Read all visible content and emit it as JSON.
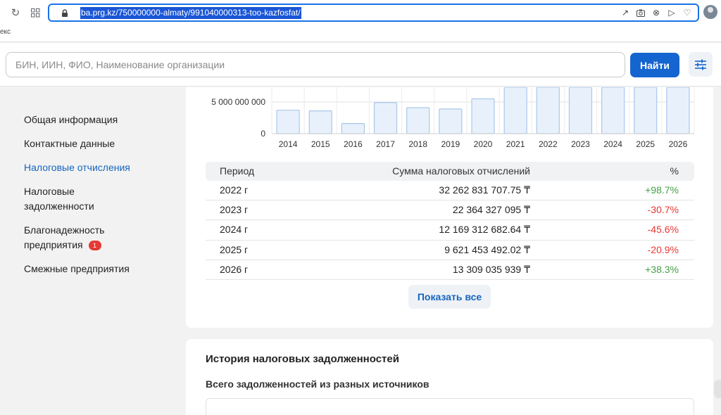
{
  "browser": {
    "url": "ba.prg.kz/750000000-almaty/991040000313-too-kazfosfat/",
    "bookmark_text": "екс"
  },
  "header": {
    "search_placeholder": "БИН, ИИН, ФИО, Наименование организации",
    "search_button": "Найти"
  },
  "sidebar": {
    "items": [
      {
        "label": "Общая информация"
      },
      {
        "label": "Контактные данные"
      },
      {
        "label": "Налоговые отчисления"
      },
      {
        "label_line1": "Налоговые",
        "label_line2": "задолженности"
      },
      {
        "label_line1": "Благонадежность",
        "label_line2": "предприятия",
        "badge": "1"
      },
      {
        "label": "Смежные предприятия"
      }
    ]
  },
  "chart_data": {
    "type": "bar",
    "categories": [
      "2014",
      "2015",
      "2016",
      "2017",
      "2018",
      "2019",
      "2020",
      "2021",
      "2022",
      "2023",
      "2024",
      "2025",
      "2026"
    ],
    "values": [
      3700000000,
      3600000000,
      1600000000,
      4900000000,
      4100000000,
      3900000000,
      5500000000,
      11000000000,
      32262831707.75,
      22364327095,
      12169312682.64,
      9621453492.02,
      13309035939
    ],
    "ytick_labels": [
      "5 000 000 000",
      "0"
    ],
    "yticks": [
      5000000000,
      0
    ],
    "ylim_visible": [
      0,
      7000000000
    ],
    "bar_color": "#e8f1fb",
    "bar_edge": "#a9c7ea"
  },
  "table": {
    "headers": {
      "period": "Период",
      "sum": "Сумма налоговых отчислений",
      "pct": "%"
    },
    "rows": [
      {
        "period": "2022 г",
        "sum": "32 262 831 707.75 ₸",
        "pct": "+98.7%",
        "positive": true
      },
      {
        "period": "2023 г",
        "sum": "22 364 327 095 ₸",
        "pct": "-30.7%",
        "positive": false
      },
      {
        "period": "2024 г",
        "sum": "12 169 312 682.64 ₸",
        "pct": "-45.6%",
        "positive": false
      },
      {
        "period": "2025 г",
        "sum": "9 621 453 492.02 ₸",
        "pct": "-20.9%",
        "positive": false
      },
      {
        "period": "2026 г",
        "sum": "13 309 035 939 ₸",
        "pct": "+38.3%",
        "positive": true
      }
    ],
    "show_all": "Показать все"
  },
  "debts": {
    "title": "История налоговых задолженностей",
    "subtitle": "Всего задолженностей из разных источников"
  },
  "colors": {
    "accent": "#1565d0",
    "positive": "#43a047",
    "negative": "#e53935"
  }
}
